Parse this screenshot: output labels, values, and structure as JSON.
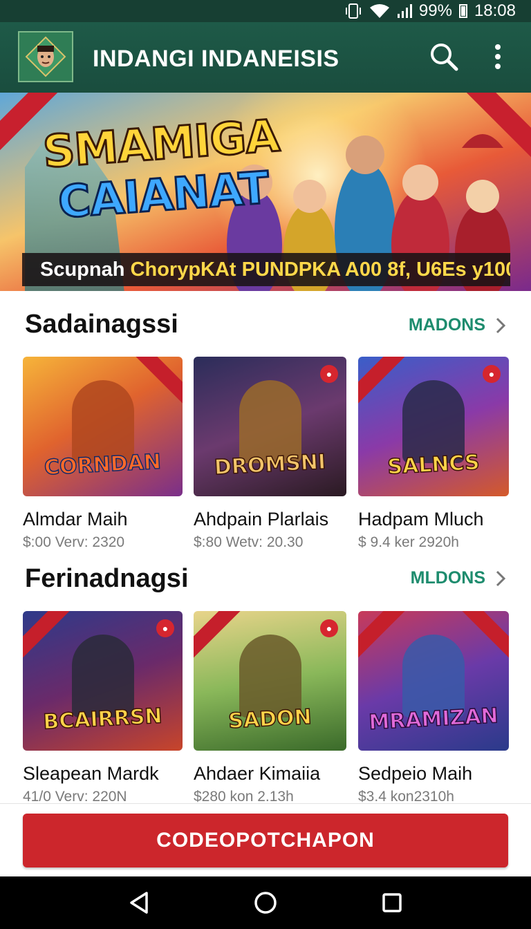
{
  "status_bar": {
    "battery": "99%",
    "time": "18:08"
  },
  "app_bar": {
    "title": "INDANGI INDANEISIS"
  },
  "hero": {
    "title_line1": "SMAMIGA",
    "title_line2": "CAIANAT",
    "subtitle_part1": "Scupnah ",
    "subtitle_part2": "ChorypKAt PUNDPKA A00 8f, U6Es y100"
  },
  "sections": [
    {
      "title": "Sadainagssi",
      "more_label": "MADONS",
      "items": [
        {
          "art_text": "CORNDAN",
          "title": "Almdar Maih",
          "meta": "$:00  Verv: 2320"
        },
        {
          "art_text": "DROMSNI",
          "title": "Ahdpain Plarlais",
          "meta": "$:80  Wetv: 20.30"
        },
        {
          "art_text": "SALNCS",
          "title": "Hadpam Mluch",
          "meta": "$ 9.4  ker 2920h"
        }
      ]
    },
    {
      "title": "Ferinadnagsi",
      "more_label": "MLDONS",
      "items": [
        {
          "art_text": "BCAIRRSN",
          "title": "Sleapean Mardk",
          "meta": "41/0  Verv: 220N"
        },
        {
          "art_text": "SADON",
          "title": "Ahdaer Kimaiia",
          "meta": "$280  kon 2.13h"
        },
        {
          "art_text": "MRAMIZAN",
          "title": "Sedpeio Maih",
          "meta": "$3.4  kon2310h"
        }
      ]
    }
  ],
  "cta_label": "CODEOPOTCHAPON",
  "colors": {
    "primary": "#1e5a48",
    "accent": "#1e8c6e",
    "cta": "#cc262c"
  }
}
